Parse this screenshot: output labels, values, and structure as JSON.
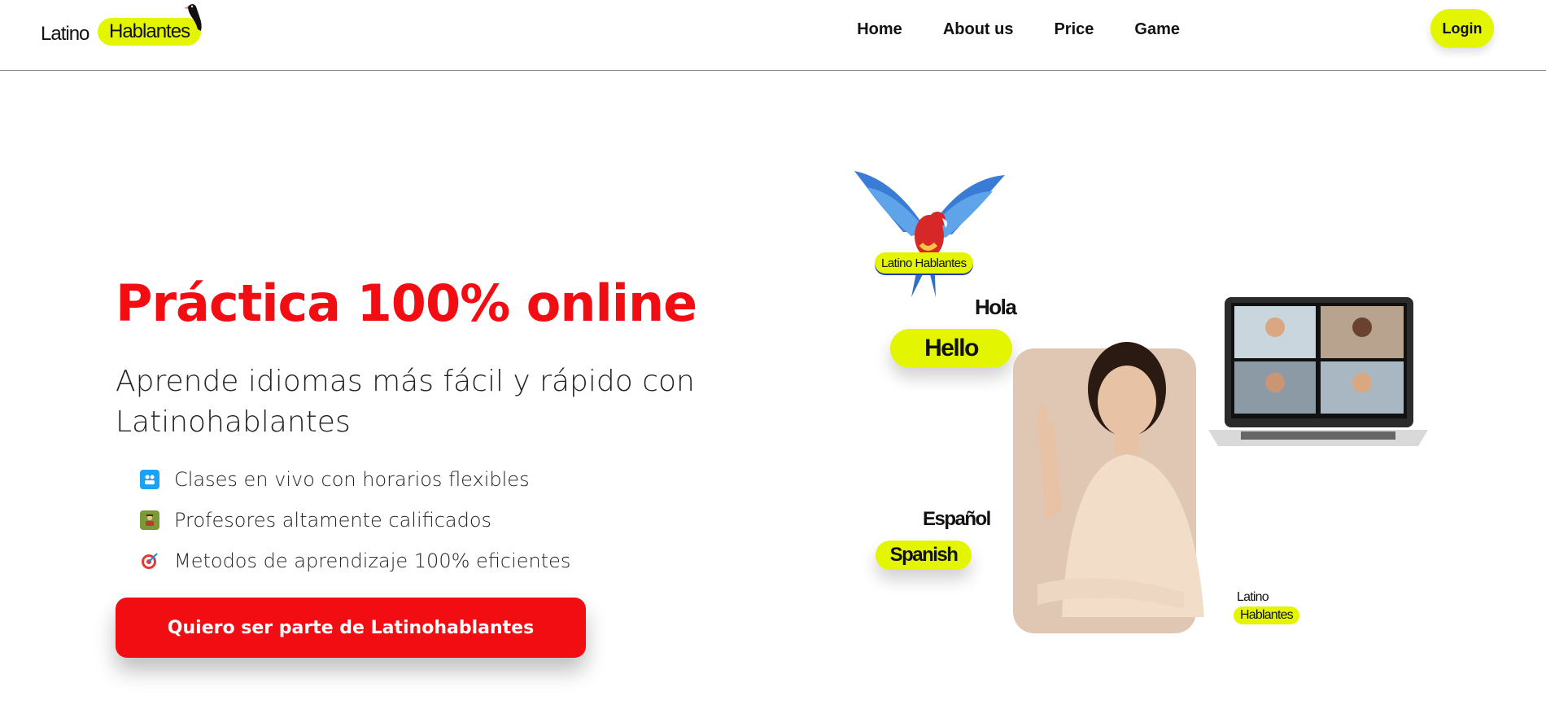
{
  "header": {
    "logo": {
      "word1": "Latino",
      "word2": "Hablantes"
    },
    "nav": [
      "Home",
      "About us",
      "Price",
      "Game"
    ],
    "login_label": "Login"
  },
  "hero": {
    "title": "Práctica 100% online",
    "subtitle": "Aprende idiomas más fácil y rápido con Latinohablantes",
    "features": [
      {
        "icon": "video-call-icon",
        "text": "Clases en vivo con horarios flexibles"
      },
      {
        "icon": "teacher-icon",
        "text": "Profesores altamente calificados"
      },
      {
        "icon": "target-icon",
        "text": "Metodos de aprendizaje 100% eficientes"
      }
    ],
    "cta_label": "Quiero ser parte de Latinohablantes"
  },
  "illustration": {
    "parrot_badge": "Latino Hablantes",
    "word_hola": "Hola",
    "word_hello": "Hello",
    "word_espanol": "Español",
    "word_spanish": "Spanish",
    "small_logo": {
      "word1": "Latino",
      "word2": "Hablantes"
    }
  },
  "colors": {
    "accent_yellow": "#e3f600",
    "brand_red": "#f20d12"
  }
}
